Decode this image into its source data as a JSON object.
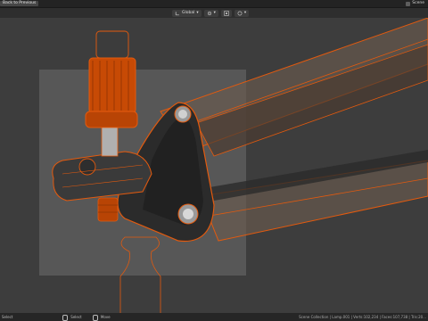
{
  "topbar": {
    "back_label": "Back to Previous",
    "scene_label": "Scene"
  },
  "header": {
    "orientation_label": "Global",
    "icons": [
      "globe-icon",
      "pivot-icon",
      "snap-icon",
      "proportional-icon"
    ]
  },
  "viewport": {
    "accent_color": "#e35a0e",
    "camera_frame_color": "#5c5c5c"
  },
  "statusbar": {
    "left_label": "Select",
    "select_label": "Select",
    "move_label": "Move",
    "stats_label": "Scene Collection | Lamp.001 | Verts:102,234 | Faces:107,738 | Tris:20..."
  }
}
